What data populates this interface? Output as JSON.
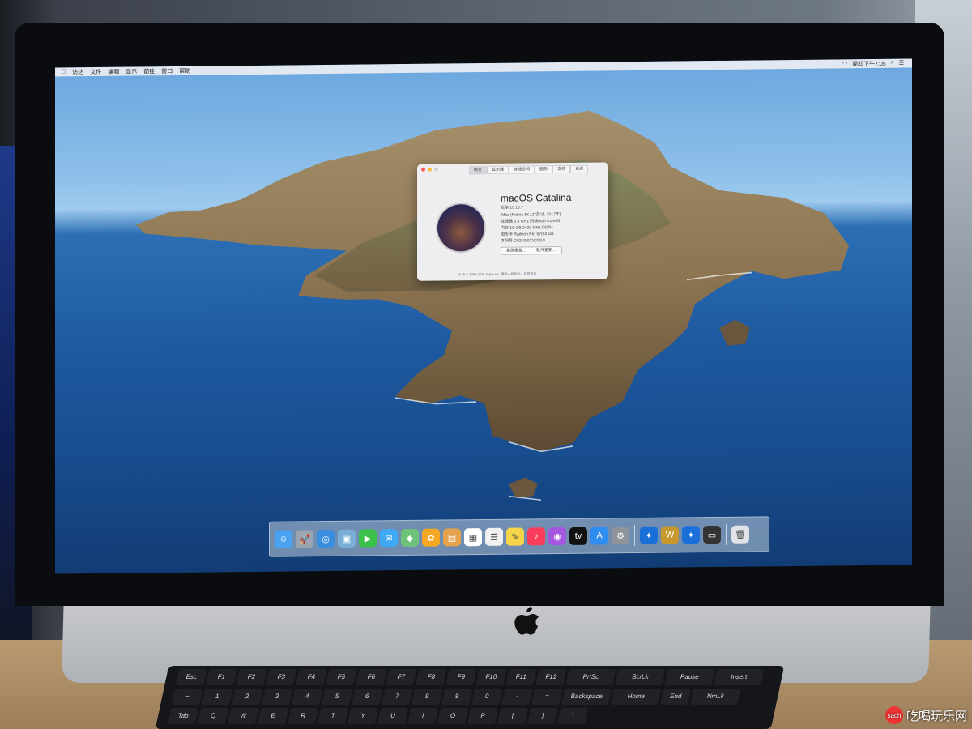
{
  "menubar": {
    "items": [
      "访达",
      "文件",
      "编辑",
      "显示",
      "前往",
      "窗口",
      "帮助"
    ],
    "clock": "周四下午7:05"
  },
  "about_window": {
    "tabs": [
      "概览",
      "显示器",
      "存储空间",
      "服务",
      "支持",
      "资源"
    ],
    "title": "macOS Catalina",
    "version": "版本 10.15.7",
    "specs": [
      "iMac (Retina 5K, 27英寸, 2017年)",
      "处理器 3.4 GHz 四核Intel Core i5",
      "内存 16 GB 2400 MHz DDR4",
      "图形卡 Radeon Pro 570 4 GB",
      "序列号 C02VQ0XXJ1GG"
    ],
    "buttons": [
      "系统报告…",
      "软件更新…"
    ],
    "copyright": "™ 和 © 1983-2020 Apple Inc. 保留一切权利。许可协议"
  },
  "dock": {
    "icons": [
      {
        "name": "finder-icon",
        "color": "#4aa3f0",
        "glyph": "☺"
      },
      {
        "name": "launchpad-icon",
        "color": "#9aa5b1",
        "glyph": "🚀"
      },
      {
        "name": "safari-icon",
        "color": "#3b8de0",
        "glyph": "◎"
      },
      {
        "name": "preview-icon",
        "color": "#7ab0d8",
        "glyph": "▣"
      },
      {
        "name": "facetime-icon",
        "color": "#3cc24a",
        "glyph": "▶"
      },
      {
        "name": "messages-icon",
        "color": "#3fa9f5",
        "glyph": "✉"
      },
      {
        "name": "maps-icon",
        "color": "#6ec27a",
        "glyph": "◆"
      },
      {
        "name": "photos-icon",
        "color": "#f5a623",
        "glyph": "✿"
      },
      {
        "name": "notes-brown-icon",
        "color": "#e3a24b",
        "glyph": "▤"
      },
      {
        "name": "calendar-icon",
        "color": "#ffffff",
        "glyph": "▦"
      },
      {
        "name": "reminders-icon",
        "color": "#f0f0f0",
        "glyph": "☰"
      },
      {
        "name": "notes-icon",
        "color": "#f7d54a",
        "glyph": "✎"
      },
      {
        "name": "music-icon",
        "color": "#fb3c5c",
        "glyph": "♪"
      },
      {
        "name": "podcasts-icon",
        "color": "#a456e0",
        "glyph": "◉"
      },
      {
        "name": "tv-icon",
        "color": "#111111",
        "glyph": "tv"
      },
      {
        "name": "app-store-icon",
        "color": "#2f8cf0",
        "glyph": "A"
      },
      {
        "name": "system-preferences-icon",
        "color": "#8e949a",
        "glyph": "⚙"
      },
      {
        "name": "battle-net-icon",
        "color": "#1a6fd8",
        "glyph": "✦"
      },
      {
        "name": "warcraft-icon",
        "color": "#c7982c",
        "glyph": "W"
      },
      {
        "name": "battle-net-2-icon",
        "color": "#1a6fd8",
        "glyph": "✦"
      },
      {
        "name": "display-icon",
        "color": "#333333",
        "glyph": "▭"
      },
      {
        "name": "trash-icon",
        "color": "#dfe3e8",
        "glyph": "🗑"
      }
    ]
  },
  "keyboard": {
    "row1": [
      "Esc",
      "F1",
      "F2",
      "F3",
      "F4",
      "F5",
      "F6",
      "F7",
      "F8",
      "F9",
      "F10",
      "F11",
      "F12",
      "PrtSc",
      "ScrLk",
      "Pause",
      "Insert"
    ],
    "row2": [
      "~",
      "1",
      "2",
      "3",
      "4",
      "5",
      "6",
      "7",
      "8",
      "9",
      "0",
      "-",
      "=",
      "Backspace",
      "Home",
      "End",
      "NmLk"
    ],
    "row3": [
      "Tab",
      "Q",
      "W",
      "E",
      "R",
      "T",
      "Y",
      "U",
      "I",
      "O",
      "P",
      "[",
      "]",
      "\\"
    ]
  },
  "watermark": {
    "badge": "sach",
    "text": "吃喝玩乐网"
  }
}
